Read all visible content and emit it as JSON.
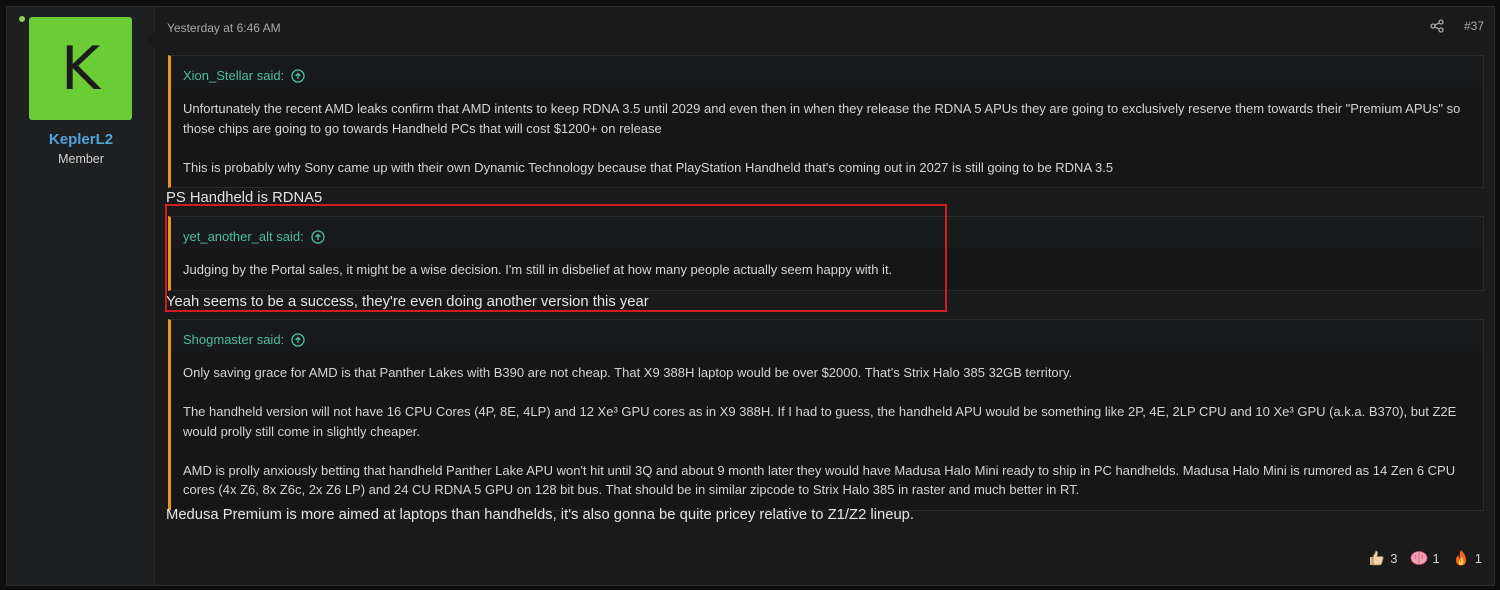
{
  "user": {
    "avatar_letter": "K",
    "username": "KeplerL2",
    "title": "Member",
    "avatar_color": "#6ccc35"
  },
  "post": {
    "date": "Yesterday at 6:46 AM",
    "number": "#37",
    "icons": {
      "share": "share-icon",
      "quote_up": "arrow-up-circle-icon"
    }
  },
  "quotes": [
    {
      "author": "Xion_Stellar said:",
      "paragraphs": [
        "Unfortunately the recent AMD leaks confirm that AMD intents to keep RDNA 3.5 until 2029 and even then in when they release the RDNA 5 APUs they are going to exclusively reserve them towards their \"Premium APUs\" so those chips are going to go towards Handheld PCs that will cost $1200+ on release",
        "This is probably why Sony came up with their own Dynamic Technology because that PlayStation Handheld that's coming out in 2027 is still going to be RDNA 3.5"
      ]
    },
    {
      "author": "yet_another_alt said:",
      "paragraphs": [
        "Judging by the Portal sales, it might be a wise decision. I'm still in disbelief at how many people actually seem happy with it."
      ]
    },
    {
      "author": "Shogmaster said:",
      "paragraphs": [
        "Only saving grace for AMD is that Panther Lakes with B390 are not cheap. That X9 388H laptop would be over $2000. That's Strix Halo 385 32GB territory.",
        "The handheld version will not have 16 CPU Cores (4P, 8E, 4LP) and 12 Xe³ GPU cores as in X9 388H. If I had to guess, the handheld APU would be something like 2P, 4E, 2LP CPU and 10 Xe³ GPU (a.k.a. B370), but Z2E would prolly still come in slightly cheaper.",
        "AMD is prolly anxiously betting that handheld Panther Lake APU won't hit until 3Q and about 9 month later they would have Madusa Halo Mini ready to ship in PC handhelds. Madusa Halo Mini is rumored as 14 Zen 6 CPU cores (4x Z6, 8x Z6c, 2x Z6 LP) and 24 CU RDNA 5 GPU on 128 bit bus. That should be in similar zipcode to Strix Halo 385 in raster and much better in RT."
      ]
    }
  ],
  "replies": [
    "PS Handheld is RDNA5",
    "Yeah seems to be a success, they're even doing another version this year",
    "Medusa Premium is more aimed at laptops than handhelds, it's also gonna be quite pricey relative to Z1/Z2 lineup."
  ],
  "reactions": [
    {
      "icon": "thumbs-up-icon",
      "count": "3"
    },
    {
      "icon": "brain-icon",
      "count": "1"
    },
    {
      "icon": "fire-icon",
      "count": "1"
    }
  ],
  "colors": {
    "quote_accent": "#e8961c",
    "quote_author": "#4dbd9f",
    "username": "#4fa3d9",
    "highlight": "#d21d20"
  }
}
